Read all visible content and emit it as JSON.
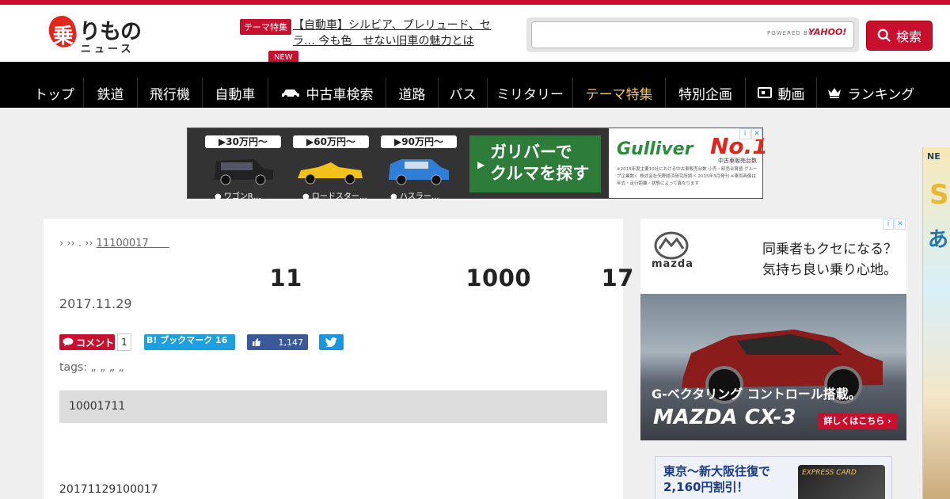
{
  "header": {
    "logo_mark": "乗",
    "logo_main": "りもの",
    "logo_sub": "ニュース",
    "theme_badge": "テーマ特集",
    "theme_link": "【自動車】シルビア、プレリュード、セラ… 今も色　せない旧車の魅力とは",
    "new_badge": "NEW",
    "search": {
      "placeholder": "",
      "powered": "POWERED BY",
      "provider": "YAHOO!",
      "button_label": "検索"
    }
  },
  "nav": {
    "items": [
      {
        "label": "トップ",
        "icon": ""
      },
      {
        "label": "鉄道",
        "icon": ""
      },
      {
        "label": "飛行機",
        "icon": ""
      },
      {
        "label": "自動車",
        "icon": ""
      },
      {
        "label": "中古車検索",
        "icon": "car-icon"
      },
      {
        "label": "道路",
        "icon": ""
      },
      {
        "label": "バス",
        "icon": ""
      },
      {
        "label": "ミリタリー",
        "icon": ""
      },
      {
        "label": "テーマ特集",
        "icon": "",
        "active": true
      },
      {
        "label": "特別企画",
        "icon": ""
      },
      {
        "label": "動画",
        "icon": "video-icon"
      },
      {
        "label": "ランキング",
        "icon": "crown-icon"
      }
    ],
    "active_color": "#f1c265"
  },
  "ad_top": {
    "cars": [
      {
        "price": "▶30万円〜",
        "name": "● ワゴンR…",
        "color": "#222222"
      },
      {
        "price": "▶60万円〜",
        "name": "● ロードスター…",
        "color": "#f2c21b"
      },
      {
        "price": "▶90万円〜",
        "name": "● ハスラー…",
        "color": "#2f7fd8"
      }
    ],
    "cta": "ガリバーで\nクルマを探す",
    "brand": "Gulliver",
    "rank": "No.1",
    "rank_sub": "中古車販売台数",
    "fine_print": "※2013年度主要10社における中古車販売台数 小売・卸売合算値 グループ企業数く 株式会社矢野経済研究所調べ 2015年3月発刊 ※車両画像は年式・走行距離・状態によって異なります"
  },
  "article": {
    "breadcrumb": {
      "prefix": "› ›› . ›› ",
      "link": "11100017　　"
    },
    "title": "　　　　　　　　　11　　　　　　　1000　　　17　　　　　　　　　　　　　",
    "date": "2017.11.29",
    "social": {
      "comment_label": "コメント",
      "comment_count": "1",
      "hatena_label": "B! ブックマーク 16",
      "fb_count": "1,147"
    },
    "tags": "tags: „ „ „ „",
    "summary": "10001711",
    "body": "20171129100017"
  },
  "ad_mazda": {
    "brand": "mazda",
    "copy1": "同乗者もクセになる？",
    "copy2": "気持ち良い乗り心地。",
    "feature": "G-ベクタリング コントロール搭載。",
    "model": "MAZDA CX-3",
    "button": "詳しくはこちら ›",
    "car_color": "#8a1c1c"
  },
  "ad_express": {
    "line1": "東京〜新大阪往復で",
    "line2": "2,160円割引！",
    "card_text": "EXPRESS CARD"
  },
  "ad_strip": {
    "ne": "NE",
    "s": "S",
    "a": "あ"
  }
}
